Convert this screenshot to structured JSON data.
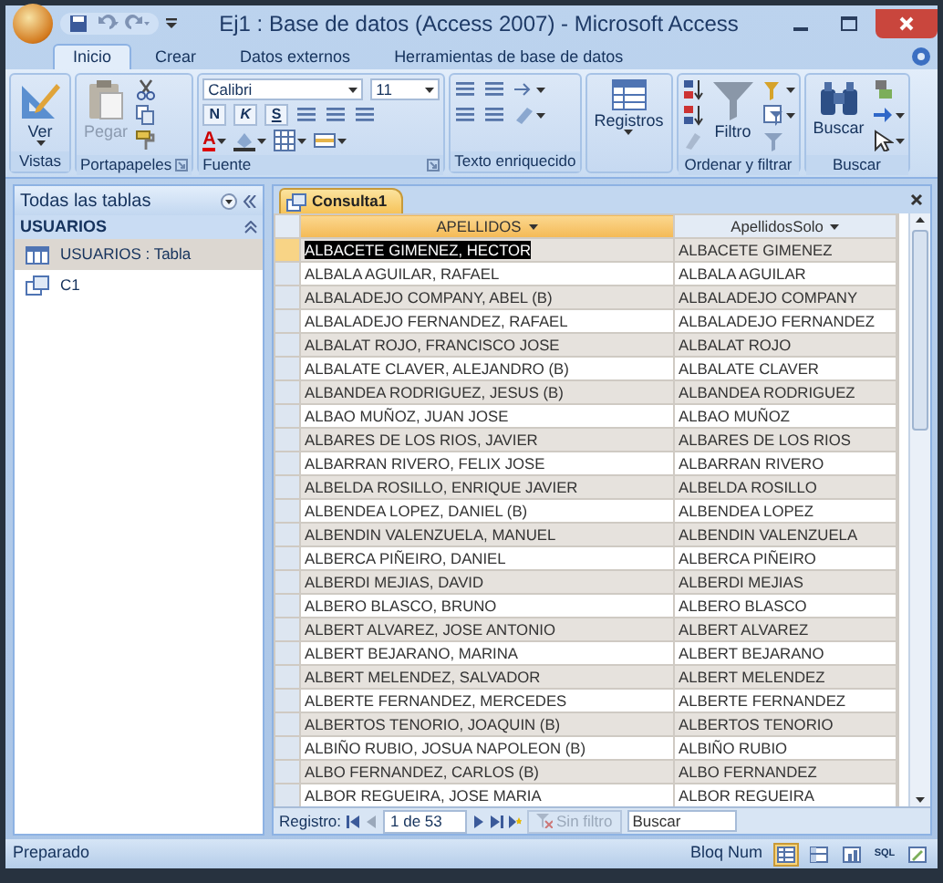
{
  "window": {
    "title": "Ej1 : Base de datos (Access 2007) - Microsoft Access"
  },
  "ribbon_tabs": [
    {
      "label": "Inicio",
      "selected": true
    },
    {
      "label": "Crear",
      "selected": false
    },
    {
      "label": "Datos externos",
      "selected": false
    },
    {
      "label": "Herramientas de base de datos",
      "selected": false
    }
  ],
  "ribbon_groups": [
    {
      "kind": "views",
      "label": "Vistas",
      "button": "Ver",
      "disabled": false
    },
    {
      "kind": "clipboard",
      "label": "Portapapeles",
      "button": "Pegar",
      "disabled": true
    },
    {
      "kind": "font",
      "label": "Fuente",
      "font": "Calibri",
      "size": "11",
      "bold": "N",
      "italic": "K",
      "underline": "S",
      "font_color": "A"
    },
    {
      "kind": "richtext",
      "label": "Texto enriquecido"
    },
    {
      "kind": "records",
      "button": "Registros",
      "disabled": false
    },
    {
      "kind": "sort",
      "label": "Ordenar y filtrar",
      "button": "Filtro",
      "disabled": false
    },
    {
      "kind": "find",
      "label": "Buscar",
      "button": "Buscar",
      "disabled": false
    }
  ],
  "navigation_pane": {
    "title": "Todas las tablas",
    "group": "USUARIOS",
    "items": [
      {
        "label": "USUARIOS : Tabla",
        "kind": "table",
        "selected": true
      },
      {
        "label": "C1",
        "kind": "query",
        "selected": false
      }
    ]
  },
  "document": {
    "tab": "Consulta1",
    "columns": [
      {
        "label": "APELLIDOS",
        "selected": true
      },
      {
        "label": "ApellidosSolo",
        "selected": false
      }
    ],
    "rows": [
      {
        "cells": [
          "ALBACETE GIMENEZ, HECTOR",
          "ALBACETE GIMENEZ"
        ],
        "selected": true
      },
      {
        "cells": [
          "ALBALA AGUILAR, RAFAEL",
          "ALBALA AGUILAR"
        ],
        "selected": false
      },
      {
        "cells": [
          "ALBALADEJO COMPANY, ABEL (B)",
          "ALBALADEJO COMPANY"
        ],
        "selected": false
      },
      {
        "cells": [
          "ALBALADEJO FERNANDEZ, RAFAEL",
          "ALBALADEJO FERNANDEZ"
        ],
        "selected": false
      },
      {
        "cells": [
          "ALBALAT ROJO, FRANCISCO JOSE",
          "ALBALAT ROJO"
        ],
        "selected": false
      },
      {
        "cells": [
          "ALBALATE CLAVER, ALEJANDRO (B)",
          "ALBALATE CLAVER"
        ],
        "selected": false
      },
      {
        "cells": [
          "ALBANDEA RODRIGUEZ, JESUS (B)",
          "ALBANDEA RODRIGUEZ"
        ],
        "selected": false
      },
      {
        "cells": [
          "ALBAO MUÑOZ, JUAN JOSE",
          "ALBAO MUÑOZ"
        ],
        "selected": false
      },
      {
        "cells": [
          "ALBARES DE LOS RIOS, JAVIER",
          "ALBARES DE LOS RIOS"
        ],
        "selected": false
      },
      {
        "cells": [
          "ALBARRAN RIVERO, FELIX JOSE",
          "ALBARRAN RIVERO"
        ],
        "selected": false
      },
      {
        "cells": [
          "ALBELDA ROSILLO, ENRIQUE JAVIER",
          "ALBELDA ROSILLO"
        ],
        "selected": false
      },
      {
        "cells": [
          "ALBENDEA LOPEZ, DANIEL (B)",
          "ALBENDEA LOPEZ"
        ],
        "selected": false
      },
      {
        "cells": [
          "ALBENDIN VALENZUELA, MANUEL",
          "ALBENDIN VALENZUELA"
        ],
        "selected": false
      },
      {
        "cells": [
          "ALBERCA PIÑEIRO, DANIEL",
          "ALBERCA PIÑEIRO"
        ],
        "selected": false
      },
      {
        "cells": [
          "ALBERDI MEJIAS, DAVID",
          "ALBERDI MEJIAS"
        ],
        "selected": false
      },
      {
        "cells": [
          "ALBERO BLASCO, BRUNO",
          "ALBERO BLASCO"
        ],
        "selected": false
      },
      {
        "cells": [
          "ALBERT ALVAREZ, JOSE ANTONIO",
          "ALBERT ALVAREZ"
        ],
        "selected": false
      },
      {
        "cells": [
          "ALBERT BEJARANO, MARINA",
          "ALBERT BEJARANO"
        ],
        "selected": false
      },
      {
        "cells": [
          "ALBERT MELENDEZ, SALVADOR",
          "ALBERT MELENDEZ"
        ],
        "selected": false
      },
      {
        "cells": [
          "ALBERTE FERNANDEZ, MERCEDES",
          "ALBERTE FERNANDEZ"
        ],
        "selected": false
      },
      {
        "cells": [
          "ALBERTOS TENORIO, JOAQUIN (B)",
          "ALBERTOS TENORIO"
        ],
        "selected": false
      },
      {
        "cells": [
          "ALBIÑO RUBIO, JOSUA NAPOLEON (B)",
          "ALBIÑO RUBIO"
        ],
        "selected": false
      },
      {
        "cells": [
          "ALBO FERNANDEZ, CARLOS (B)",
          "ALBO FERNANDEZ"
        ],
        "selected": false
      },
      {
        "cells": [
          "ALBOR REGUEIRA, JOSE MARIA",
          "ALBOR REGUEIRA"
        ],
        "selected": false
      }
    ],
    "record_navigator": {
      "label": "Registro:",
      "position": "1 de 53",
      "filter": "Sin filtro",
      "filter_disabled": true,
      "search_placeholder": "Buscar"
    }
  },
  "status_bar": {
    "left": "Preparado",
    "right": "Bloq Num",
    "views": [
      {
        "kind": "datasheet",
        "selected": true
      },
      {
        "kind": "pivot-table",
        "selected": false
      },
      {
        "kind": "pivot-chart",
        "selected": false
      },
      {
        "kind": "sql",
        "label": "SQL",
        "selected": false
      },
      {
        "kind": "design",
        "selected": false
      }
    ]
  }
}
